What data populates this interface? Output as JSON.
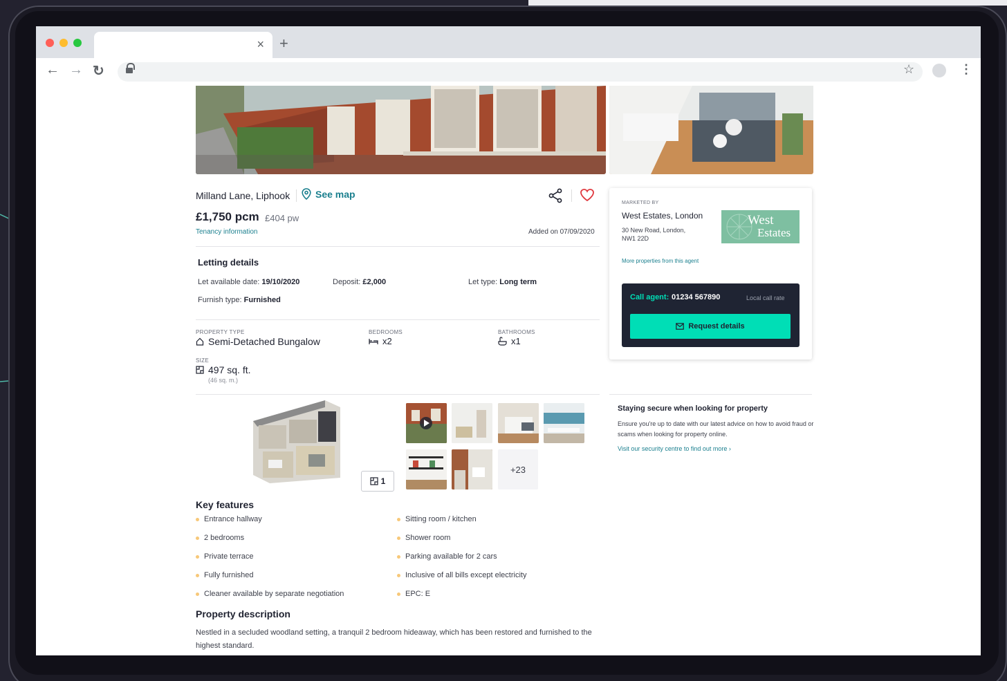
{
  "browser": {
    "tab_close": "×",
    "new_tab": "+",
    "back": "←",
    "forward": "→",
    "reload": "↻",
    "star": "☆",
    "menu": "⋮"
  },
  "listing": {
    "address": "Milland Lane, Liphook",
    "see_map": "See map",
    "price": "£1,750 pcm",
    "price_pw": "£404 pw",
    "tenancy_link": "Tenancy information",
    "added": "Added on 07/09/2020"
  },
  "letting": {
    "title": "Letting details",
    "available_label": "Let available date:",
    "available_value": "19/10/2020",
    "deposit_label": "Deposit:",
    "deposit_value": "£2,000",
    "let_type_label": "Let type:",
    "let_type_value": "Long term",
    "furnish_label": "Furnish type:",
    "furnish_value": "Furnished"
  },
  "property": {
    "type_label": "PROPERTY TYPE",
    "type_value": "Semi-Detached Bungalow",
    "bedrooms_label": "BEDROOMS",
    "bedrooms_value": "x2",
    "bathrooms_label": "BATHROOMS",
    "bathrooms_value": "x1",
    "size_label": "SIZE",
    "size_value": "497 sq. ft.",
    "size_metric": "(46 sq. m.)"
  },
  "media": {
    "floorplan_count": "1",
    "more_photos": "+23"
  },
  "key_features": {
    "title": "Key features",
    "left": [
      "Entrance hallway",
      "2 bedrooms",
      "Private terrace",
      "Fully furnished",
      "Cleaner available by separate negotiation"
    ],
    "right": [
      "Sitting room / kitchen",
      "Shower room",
      "Parking available for 2 cars",
      "Inclusive of all bills except electricity",
      "EPC: E"
    ]
  },
  "description": {
    "title": "Property description",
    "text": "Nestled in a secluded woodland setting, a tranquil 2 bedroom hideaway, which has been restored and furnished to the highest standard."
  },
  "agent": {
    "marketed_by": "MARKETED BY",
    "name": "West Estates, London",
    "address_line1": "30 New Road, London,",
    "address_line2": "NW1 22D",
    "logo_line1": "West",
    "logo_line2": "Estates",
    "more_link": "More properties from this agent",
    "call_label": "Call agent:",
    "phone": "01234 567890",
    "call_rate": "Local call rate",
    "request_button": "Request details"
  },
  "security": {
    "title": "Staying secure when looking for property",
    "body": "Ensure you're up to date with our latest advice on how to avoid fraud or scams when looking for property online.",
    "link": "Visit our security centre to find out more  ›"
  },
  "colors": {
    "accent_teal": "#1a7f8e",
    "button_green": "#00deb6",
    "bullet_yellow": "#f7c879",
    "heart_red": "#e0383e",
    "callout_line": "#4fb7a7"
  }
}
